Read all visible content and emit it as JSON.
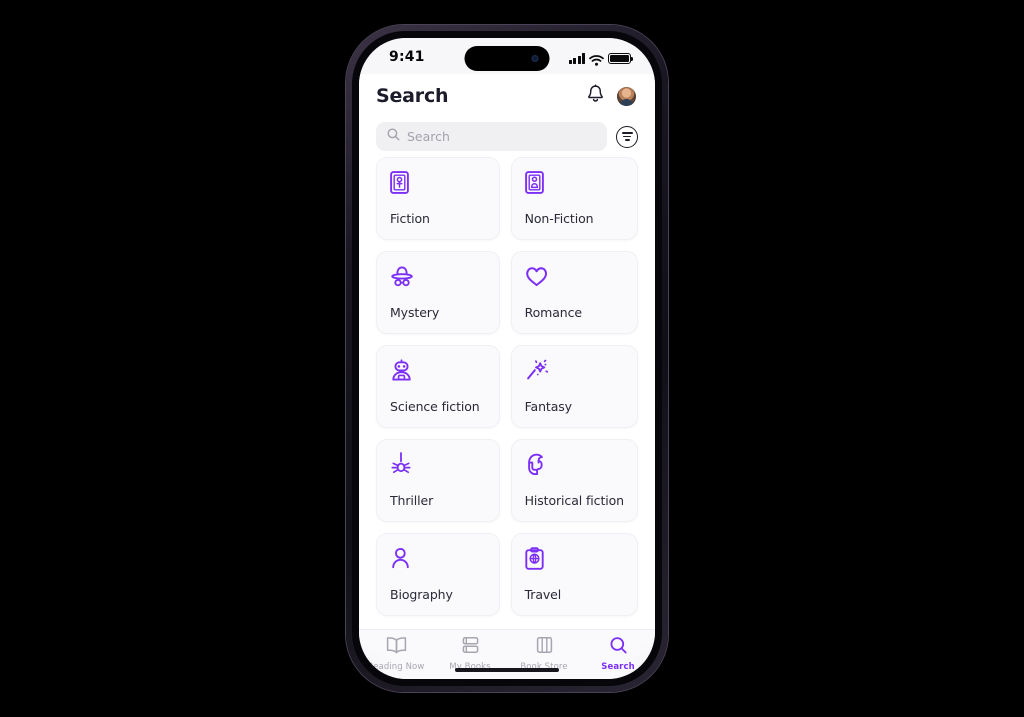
{
  "status_bar": {
    "time": "9:41",
    "icons": [
      "cellular-signal-icon",
      "wifi-icon",
      "battery-icon"
    ]
  },
  "header": {
    "title": "Search",
    "notification_icon": "bell-icon",
    "avatar": "user-avatar"
  },
  "search": {
    "placeholder": "Search",
    "value": "",
    "search_icon": "magnifier-icon",
    "filter_icon": "filter-lines-circle-icon"
  },
  "categories": [
    {
      "label": "Fiction",
      "icon": "fiction-book-icon"
    },
    {
      "label": "Non-Fiction",
      "icon": "nonfiction-book-icon"
    },
    {
      "label": "Mystery",
      "icon": "detective-hat-icon"
    },
    {
      "label": "Romance",
      "icon": "double-heart-icon"
    },
    {
      "label": "Science fiction",
      "icon": "robot-icon"
    },
    {
      "label": "Fantasy",
      "icon": "magic-wand-icon"
    },
    {
      "label": "Thriller",
      "icon": "spider-icon"
    },
    {
      "label": "Historical fiction",
      "icon": "spartan-helmet-icon"
    },
    {
      "label": "Biography",
      "icon": "person-portrait-icon"
    },
    {
      "label": "Travel",
      "icon": "clipboard-globe-icon"
    }
  ],
  "tab_bar": {
    "tabs": [
      {
        "label": "Reading Now",
        "icon": "open-book-icon",
        "active": false
      },
      {
        "label": "My Books",
        "icon": "stacked-books-icon",
        "active": false
      },
      {
        "label": "Book Store",
        "icon": "bookshelf-icon",
        "active": false
      },
      {
        "label": "Search",
        "icon": "magnifier-icon",
        "active": true
      }
    ]
  },
  "colors": {
    "accent": "#7B2FF7",
    "screen_bg": "#FFFFFF",
    "card_bg": "#FAFAFC",
    "text_primary": "#2A2A38",
    "text_muted": "#A6A6B0",
    "page_bg": "#000000"
  }
}
